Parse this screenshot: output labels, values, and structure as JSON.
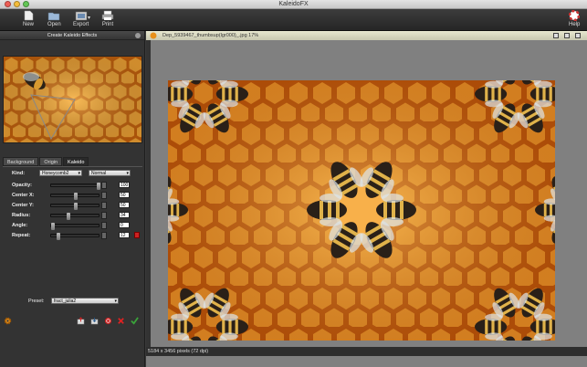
{
  "window": {
    "title": "KaleidoFX"
  },
  "toolbar": {
    "new_label": "New",
    "open_label": "Open",
    "export_label": "Export",
    "print_label": "Print",
    "help_label": "Help"
  },
  "left_panel": {
    "header": "Create Kaleido Effects",
    "tabs": [
      "Background",
      "Origin",
      "Kaleido"
    ],
    "active_tab": "Kaleido",
    "kind": {
      "label": "Kind:",
      "value": "Honeycomb2",
      "blend": "Normal"
    },
    "params": [
      {
        "label": "Opacity:",
        "value": "100",
        "level": 1.0
      },
      {
        "label": "Center X:",
        "value": "50",
        "level": 0.5
      },
      {
        "label": "Center Y:",
        "value": "50",
        "level": 0.5
      },
      {
        "label": "Radius:",
        "value": "34",
        "level": 0.34
      },
      {
        "label": "Angle:",
        "value": "0",
        "level": 0.0
      },
      {
        "label": "Repeat:",
        "value": "12",
        "level": 0.12
      }
    ],
    "preset": {
      "label": "Preset:",
      "value": "fract_julia2"
    }
  },
  "document": {
    "title": "Dep_5939467_thumbsup(lgr000)_.jpg 17%",
    "status": "5184 x 3456 pixels (72 dpi)"
  },
  "colors": {
    "accent": "#e8901a",
    "honey": "#f29a28",
    "honey_dark": "#b85a08",
    "reset_red": "#c22222",
    "ok_green": "#3aa33a"
  }
}
